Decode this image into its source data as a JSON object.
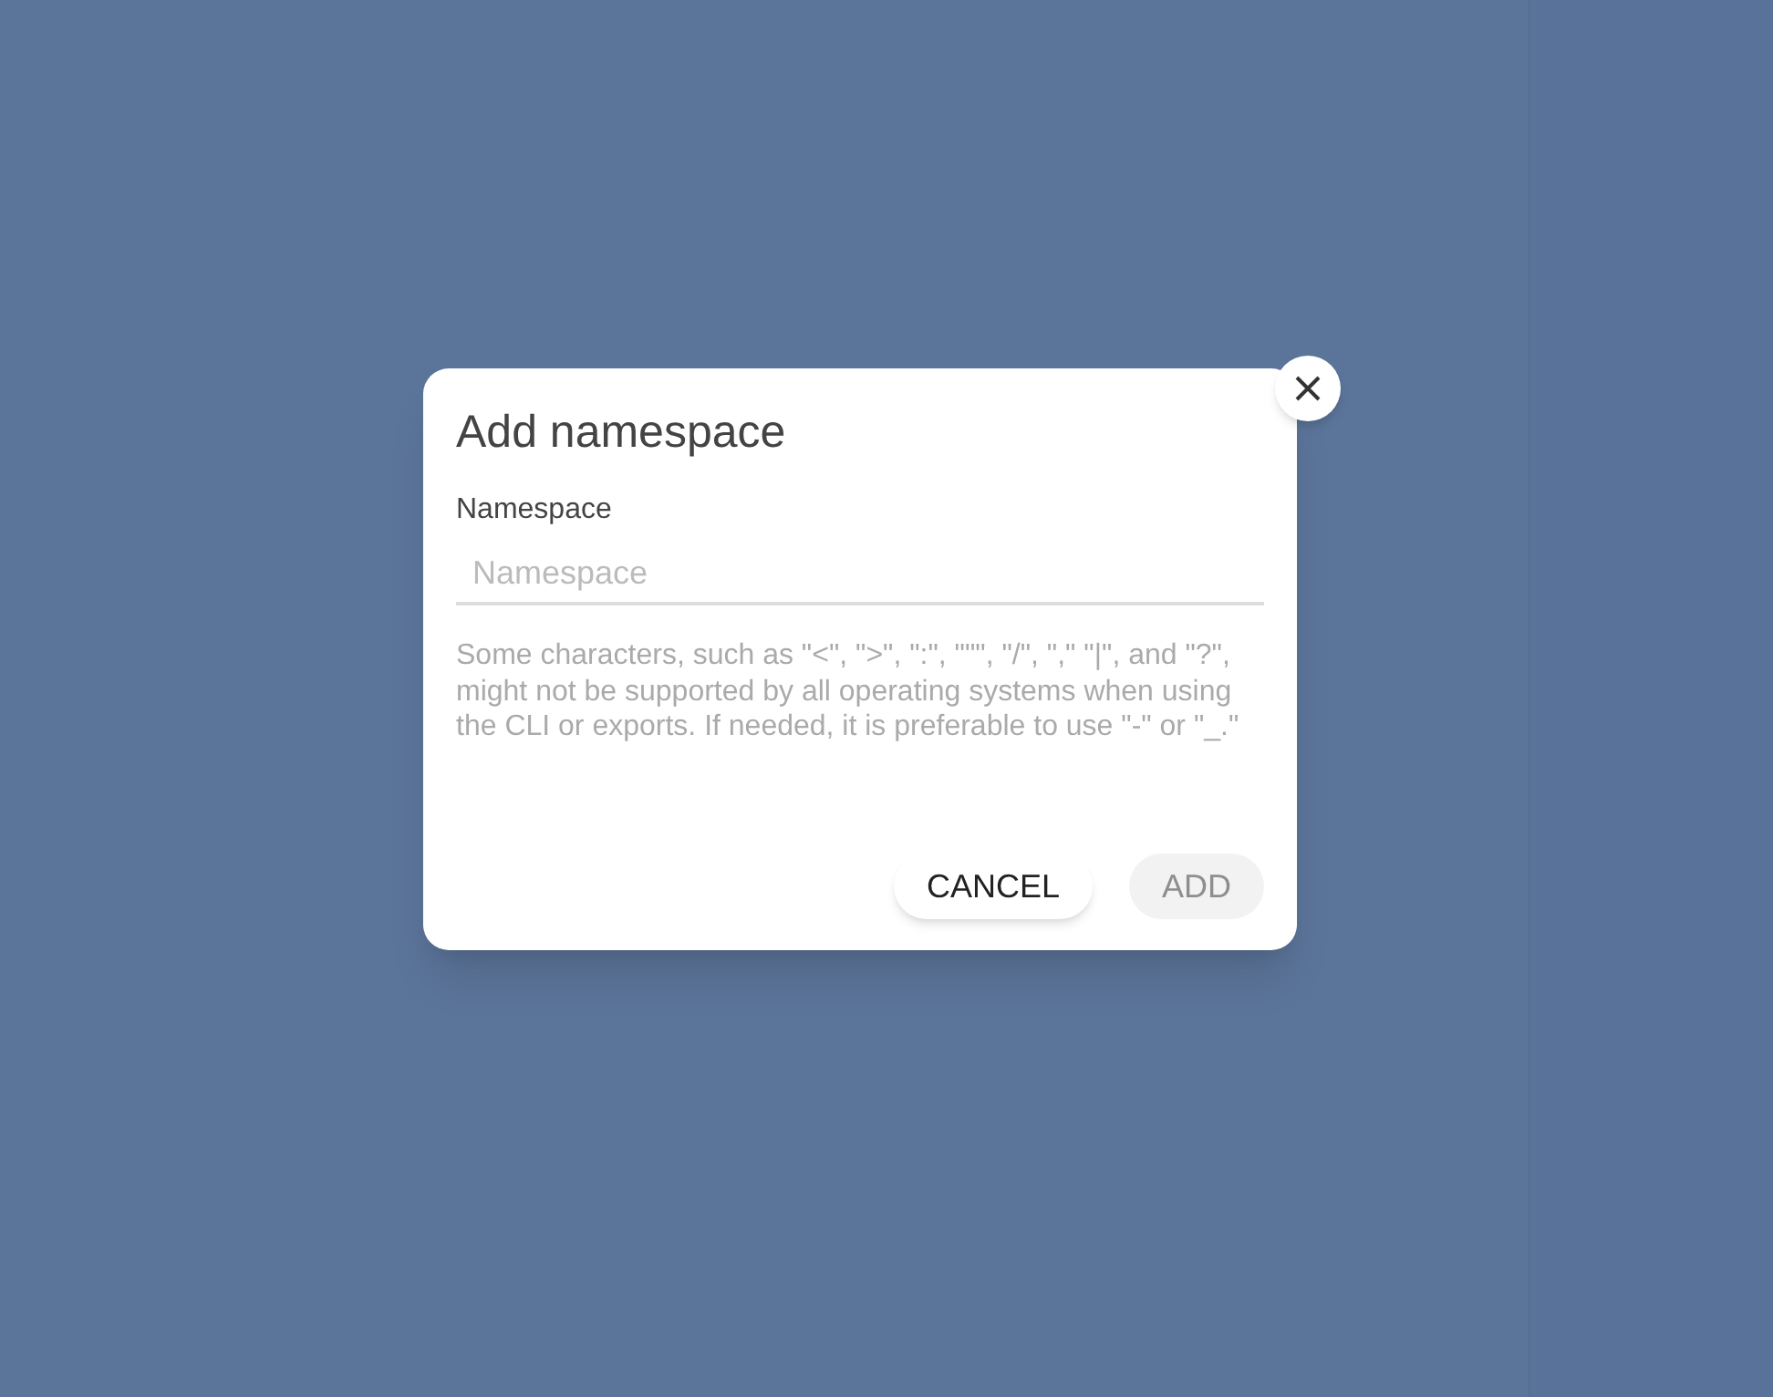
{
  "dialog": {
    "title": "Add namespace",
    "field": {
      "label": "Namespace",
      "placeholder": "Namespace"
    },
    "help": "Some characters, such as \"<\", \">\", \":\", \"\"\", \"/\", \",\" \"|\", and \"?\", might not be supported by all operating systems when using the CLI or exports. If needed, it is preferable to use \"-\" or \"_.\"",
    "buttons": [
      {
        "label": "CANCEL",
        "disabled": false
      },
      {
        "label": "ADD",
        "disabled": true
      }
    ]
  }
}
